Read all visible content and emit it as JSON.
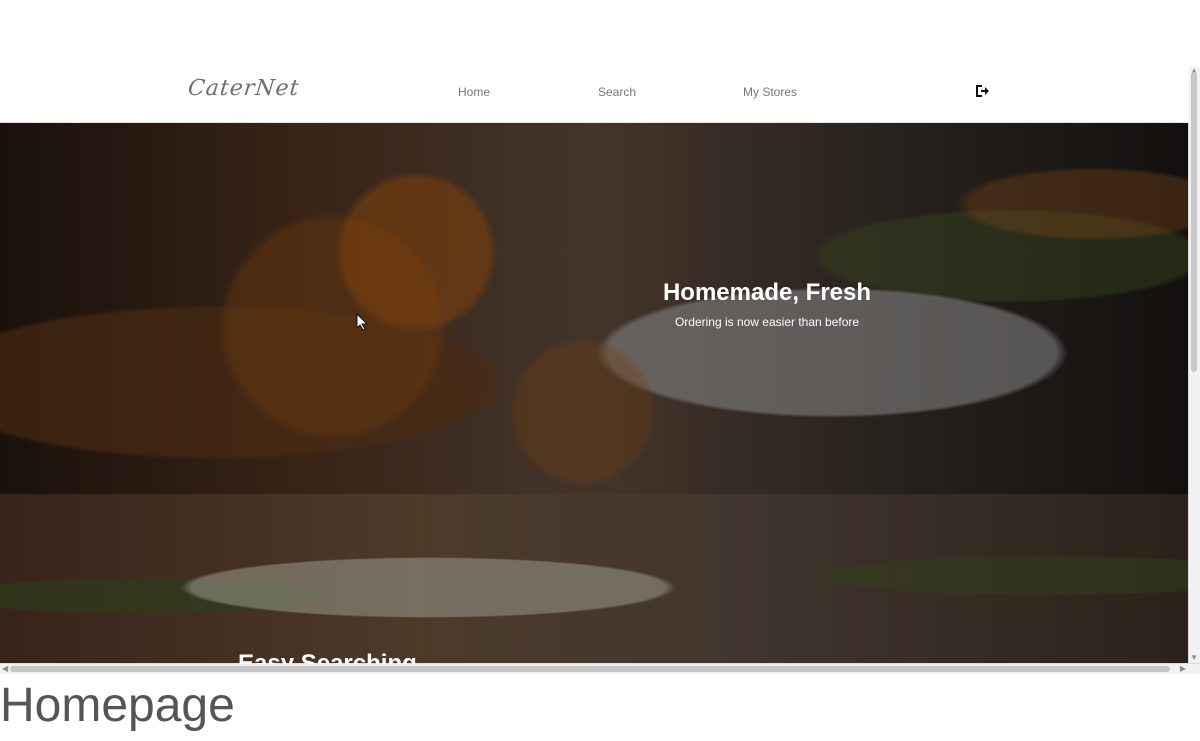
{
  "navbar": {
    "brand": "CaterNet",
    "links": [
      {
        "label": "Home"
      },
      {
        "label": "Search"
      },
      {
        "label": "My Stores"
      }
    ],
    "logout_icon": "sign-out-icon"
  },
  "hero": {
    "title": "Homemade, Fresh",
    "subtitle": "Ordering is now easier than before"
  },
  "feature": {
    "title": "Easy Searching"
  },
  "caption": {
    "text": "Homepage"
  },
  "colors": {
    "nav_text": "#777777",
    "hero_text": "#ffffff",
    "caption_text": "#555555"
  }
}
